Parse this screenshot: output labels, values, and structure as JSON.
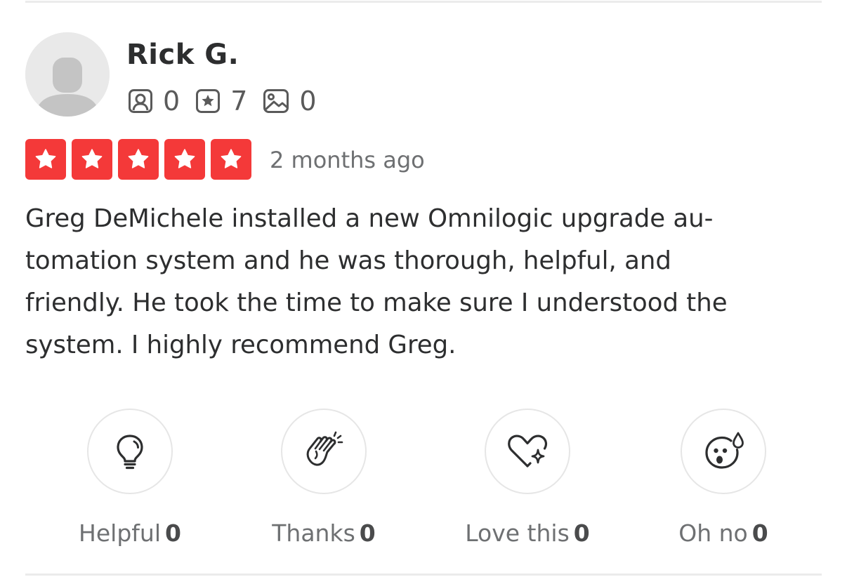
{
  "review": {
    "user": {
      "name": "Rick G.",
      "avatar_icon": "default-user-silhouette-icon",
      "stats": [
        {
          "icon": "friends-icon",
          "value": "0"
        },
        {
          "icon": "reviews-star-icon",
          "value": "7"
        },
        {
          "icon": "photos-icon",
          "value": "0"
        }
      ]
    },
    "rating": {
      "stars": 5,
      "max": 5,
      "star_color": "#f43939"
    },
    "date": "2 months ago",
    "text": "Greg DeMichele installed a new Omnilogic upgrade au-\ntomation system and he was thorough, helpful, and\nfriendly. He took the time to make sure I understood the\nsystem. I highly recommend Greg.",
    "reactions": [
      {
        "icon": "lightbulb-icon",
        "label": "Helpful",
        "count": "0"
      },
      {
        "icon": "clapping-hands-icon",
        "label": "Thanks",
        "count": "0"
      },
      {
        "icon": "heart-sparkle-icon",
        "label": "Love this",
        "count": "0"
      },
      {
        "icon": "surprised-face-icon",
        "label": "Oh no",
        "count": "0"
      }
    ]
  }
}
